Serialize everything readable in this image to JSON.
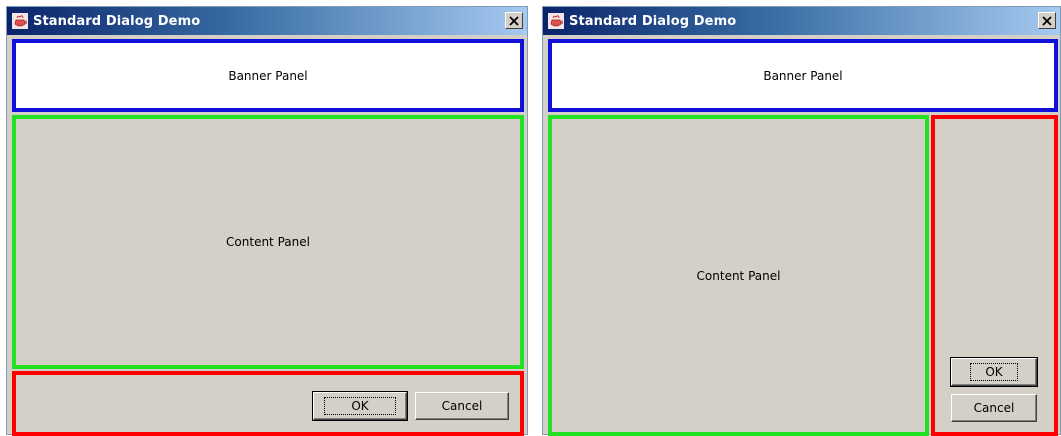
{
  "left_dialog": {
    "title": "Standard Dialog Demo",
    "banner_label": "Banner Panel",
    "content_label": "Content Panel",
    "ok_label": "OK",
    "cancel_label": "Cancel"
  },
  "right_dialog": {
    "title": "Standard Dialog Demo",
    "banner_label": "Banner Panel",
    "content_label": "Content Panel",
    "ok_label": "OK",
    "cancel_label": "Cancel"
  },
  "colors": {
    "banner_border": "#1010d8",
    "content_border": "#22e022",
    "buttons_border": "#ff0000",
    "dialog_background": "#d4d0c8"
  },
  "icons": {
    "app": "java-coffee-cup-icon",
    "close": "close-icon"
  }
}
